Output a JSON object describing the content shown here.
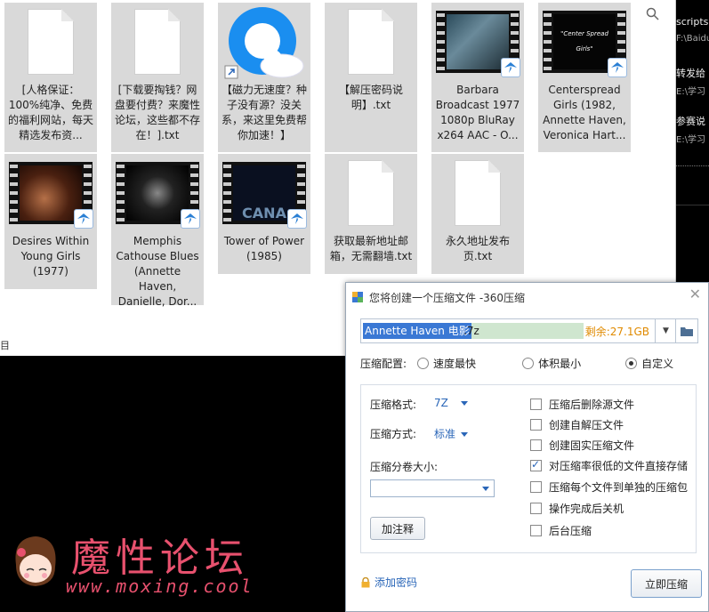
{
  "explorer": {
    "status_text": "目",
    "files": [
      {
        "kind": "doc",
        "name": "[人格保证：100%纯净、免费的福利网站，每天精选发布资..."
      },
      {
        "kind": "doc",
        "name": "[下载要掏钱？网盘要付费？来魔性论坛，这些都不存在！].txt"
      },
      {
        "kind": "link",
        "name": "【磁力无速度？种子没有源？没关系，来这里免费帮你加速！】"
      },
      {
        "kind": "doc",
        "name": "【解压密码说明】.txt"
      },
      {
        "kind": "video",
        "name": "Barbara Broadcast 1977 1080p BluRay x264 AAC - O..."
      },
      {
        "kind": "video",
        "name": "Centerspread Girls (1982, Annette Haven, Veronica Hart..."
      },
      {
        "kind": "video",
        "name": "Desires Within Young Girls (1977)"
      },
      {
        "kind": "video",
        "name": "Memphis Cathouse Blues (Annette Haven, Danielle, Dor..."
      },
      {
        "kind": "video",
        "name": "Tower of Power (1985)"
      },
      {
        "kind": "doc",
        "name": "获取最新地址邮箱，无需翻墙.txt"
      },
      {
        "kind": "doc",
        "name": "永久地址发布页.txt"
      }
    ],
    "thumb_title_centerspread": "\"Center Spread Girls\"",
    "thumb_title_tower": "CANA"
  },
  "right_panel": [
    {
      "title": "scripts",
      "sub": "F:\\Baidu"
    },
    {
      "title": "转发给",
      "sub": "E:\\学习"
    },
    {
      "title": "参赛说",
      "sub": "E:\\学习"
    }
  ],
  "watermark": {
    "text": "魔性论坛",
    "url": "www.moxing.cool"
  },
  "dialog": {
    "title": "您将创建一个压缩文件 -360压缩",
    "path_selected": "Annette Haven 电影",
    "path_rest": ".7z",
    "free_space": "剩余:27.1GB",
    "config_label": "压缩配置:",
    "config_options": [
      "速度最快",
      "体积最小",
      "自定义"
    ],
    "config_selected": 2,
    "format_label": "压缩格式:",
    "format_value": "7Z",
    "method_label": "压缩方式:",
    "method_value": "标准",
    "split_label": "压缩分卷大小:",
    "split_value": "",
    "comment_button": "加注释",
    "checkboxes": [
      {
        "label": "压缩后删除源文件",
        "checked": false
      },
      {
        "label": "创建自解压文件",
        "checked": false
      },
      {
        "label": "创建固实压缩文件",
        "checked": false
      },
      {
        "label": "对压缩率很低的文件直接存储",
        "checked": true
      },
      {
        "label": "压缩每个文件到单独的压缩包",
        "checked": false
      },
      {
        "label": "操作完成后关机",
        "checked": false
      },
      {
        "label": "后台压缩",
        "checked": false
      }
    ],
    "add_password": "添加密码",
    "compress_button": "立即压缩"
  }
}
